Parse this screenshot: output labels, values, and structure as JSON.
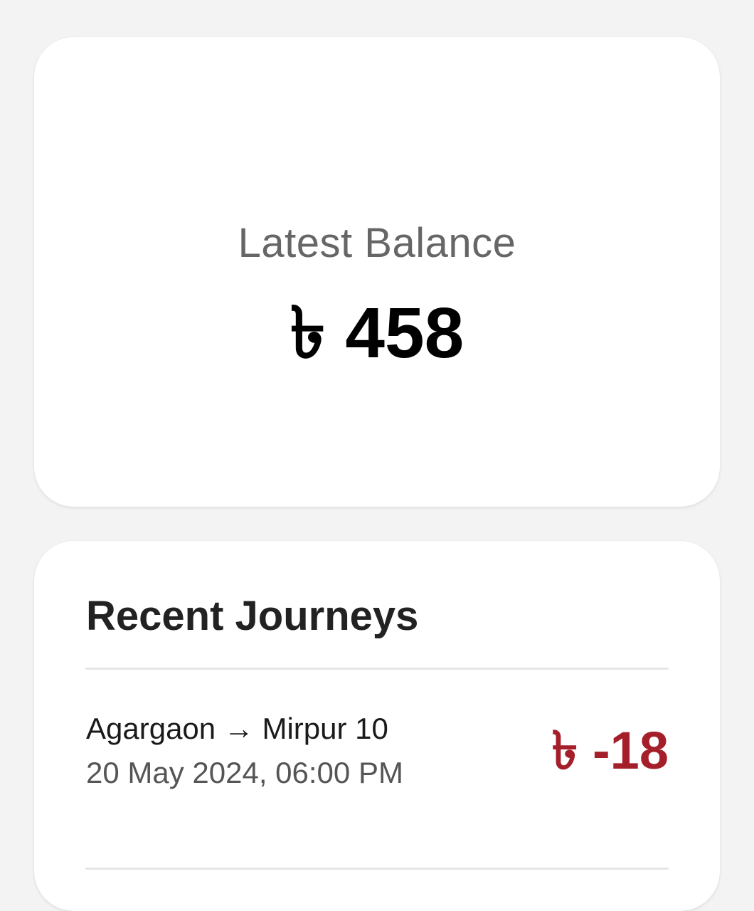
{
  "balance": {
    "label": "Latest Balance",
    "amount": "৳ 458"
  },
  "recent_journeys": {
    "title": "Recent Journeys",
    "items": [
      {
        "route": "Agargaon → Mirpur 10",
        "datetime": "20 May 2024, 06:00 PM",
        "fare": "৳ -18"
      }
    ]
  },
  "colors": {
    "background": "#f3f3f3",
    "card": "#ffffff",
    "fare_negative": "#a51f2a",
    "label_gray": "#666666"
  }
}
